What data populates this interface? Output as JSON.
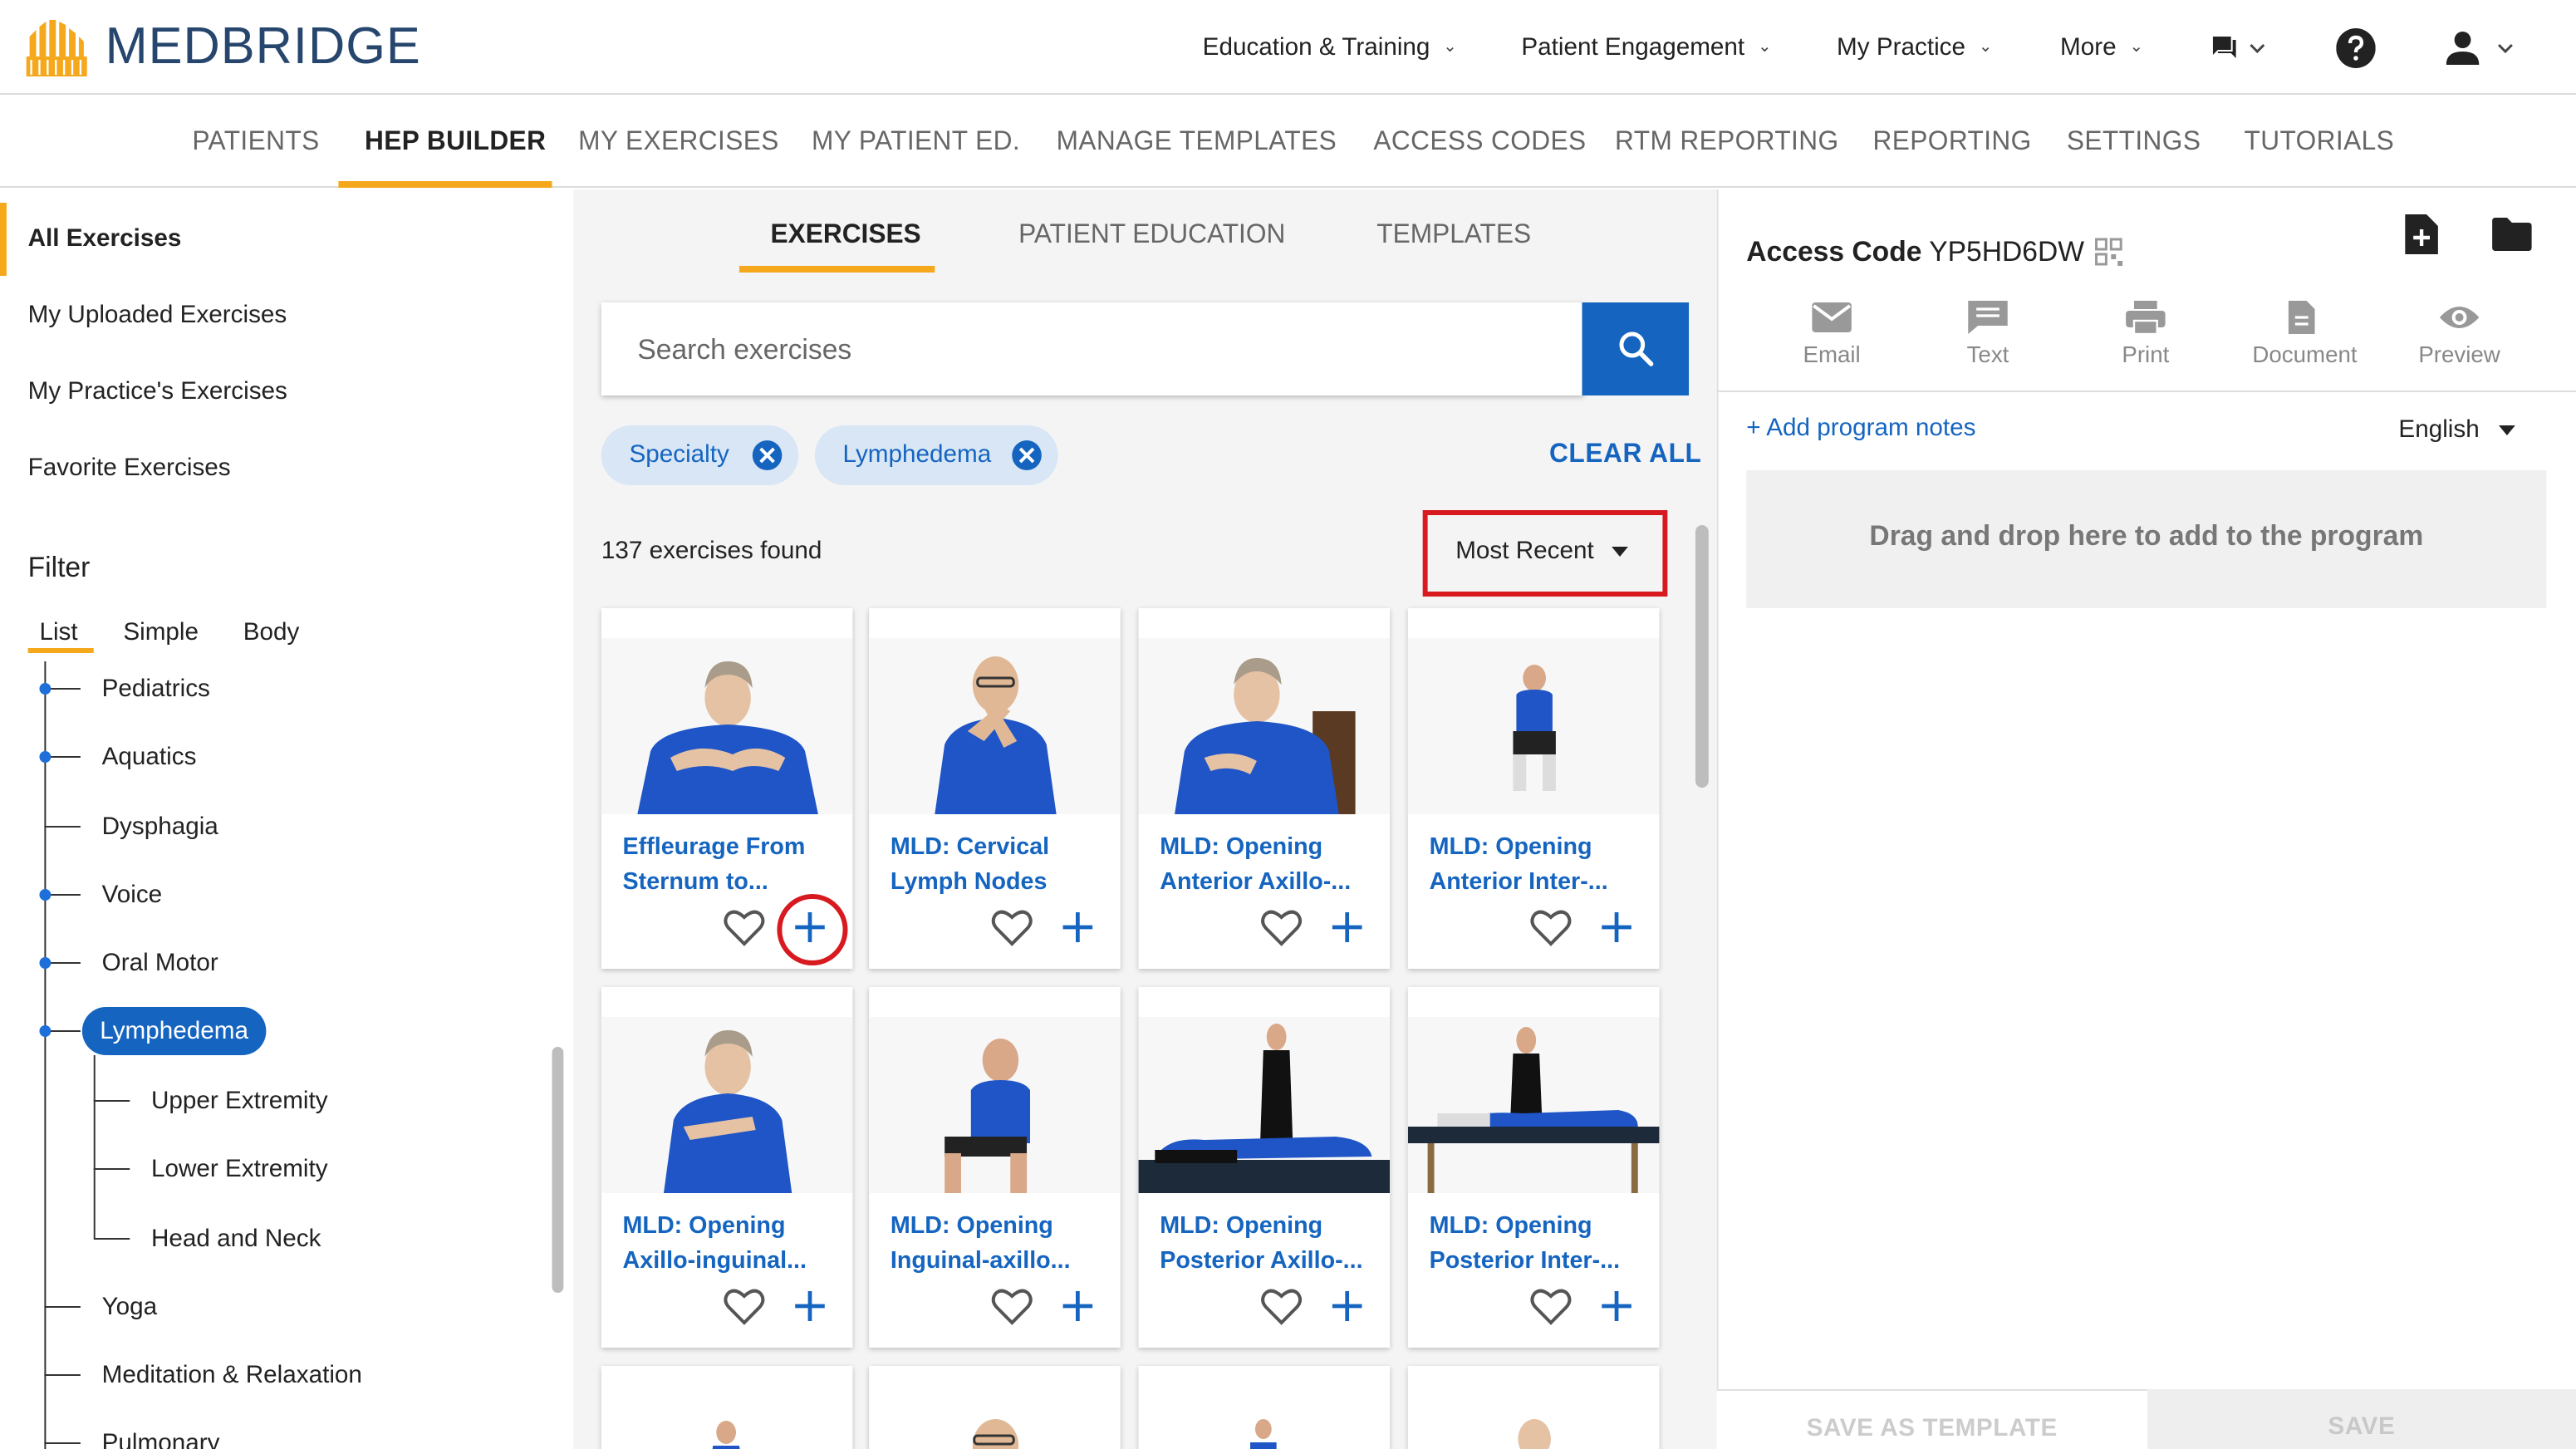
{
  "brand": {
    "name": "MEDBRIDGE",
    "logo_color": "#f5a81c",
    "text_color": "#26466d"
  },
  "top_nav": {
    "items": [
      "Education & Training",
      "Patient Engagement",
      "My Practice",
      "More"
    ],
    "chat_icon": "chat-icon",
    "help_icon": "help-icon",
    "user_icon": "user-icon"
  },
  "sub_nav": {
    "items": [
      "PATIENTS",
      "HEP BUILDER",
      "MY EXERCISES",
      "MY PATIENT ED.",
      "MANAGE TEMPLATES",
      "ACCESS CODES",
      "RTM REPORTING",
      "REPORTING",
      "SETTINGS",
      "TUTORIALS"
    ],
    "active": "HEP BUILDER"
  },
  "sidebar": {
    "items": [
      "All Exercises",
      "My Uploaded Exercises",
      "My Practice's Exercises",
      "Favorite Exercises"
    ],
    "active": "All Exercises",
    "filter_title": "Filter",
    "filter_tabs": [
      "List",
      "Simple",
      "Body"
    ],
    "filter_active": "List",
    "tree": [
      "Pediatrics",
      "Aquatics",
      "Dysphagia",
      "Voice",
      "Oral Motor",
      "Lymphedema",
      "Upper Extremity",
      "Lower Extremity",
      "Head and Neck",
      "Yoga",
      "Meditation & Relaxation",
      "Pulmonary"
    ],
    "tree_selected": "Lymphedema"
  },
  "main": {
    "tabs": [
      "EXERCISES",
      "PATIENT EDUCATION",
      "TEMPLATES"
    ],
    "active_tab": "EXERCISES",
    "search": {
      "placeholder": "Search exercises",
      "icon": "search-icon"
    },
    "chips": [
      "Specialty",
      "Lymphedema"
    ],
    "clear_all": "CLEAR ALL",
    "count_text": "137 exercises found",
    "sort": {
      "selected": "Most Recent"
    },
    "cards": [
      {
        "title_1": "Effleurage From",
        "title_2": "Sternum to..."
      },
      {
        "title_1": "MLD: Cervical",
        "title_2": "Lymph Nodes"
      },
      {
        "title_1": "MLD: Opening",
        "title_2": "Anterior Axillo-..."
      },
      {
        "title_1": "MLD: Opening",
        "title_2": "Anterior Inter-..."
      },
      {
        "title_1": "MLD: Opening",
        "title_2": "Axillo-inguinal..."
      },
      {
        "title_1": "MLD: Opening",
        "title_2": "Inguinal-axillo..."
      },
      {
        "title_1": "MLD: Opening",
        "title_2": "Posterior Axillo-..."
      },
      {
        "title_1": "MLD: Opening",
        "title_2": "Posterior Inter-..."
      }
    ]
  },
  "program": {
    "access_code_label": "Access Code",
    "access_code": "YP5HD6DW",
    "actions": [
      "Email",
      "Text",
      "Print",
      "Document",
      "Preview"
    ],
    "add_notes": "+ Add program notes",
    "language": "English",
    "drop_text": "Drag and drop here to add to the program",
    "save_template": "SAVE AS TEMPLATE",
    "save": "SAVE"
  },
  "colors": {
    "accent": "#f5a81c",
    "primary": "#1565c0",
    "highlight": "#d71920"
  }
}
